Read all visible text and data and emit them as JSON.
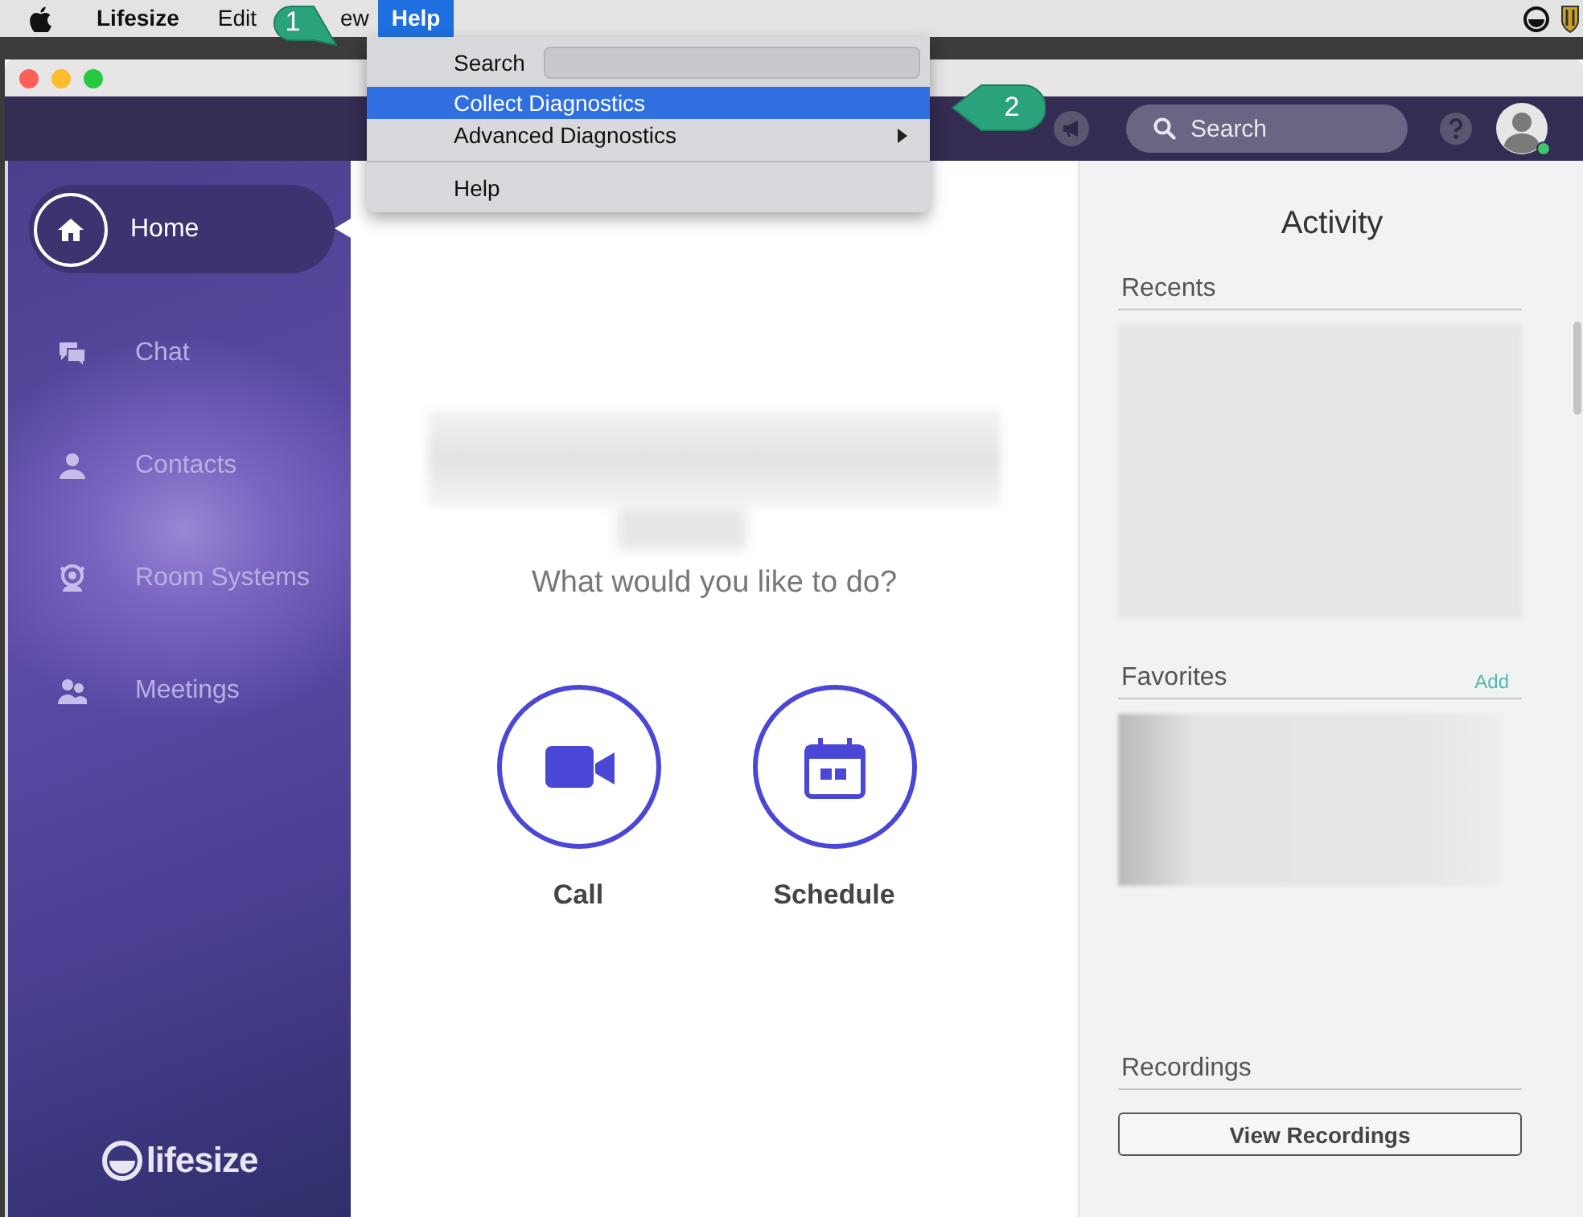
{
  "menu_bar": {
    "items": [
      {
        "label": "Lifesize",
        "kind": "app",
        "selected": false
      },
      {
        "label": "Edit",
        "kind": "menu",
        "selected": false
      },
      {
        "label": "ew",
        "kind": "clipped",
        "selected": false
      },
      {
        "label": "Help",
        "kind": "menu",
        "selected": true
      }
    ]
  },
  "help_menu": {
    "items": [
      {
        "kind": "search",
        "label": "Search"
      },
      {
        "kind": "item",
        "label": "Collect Diagnostics",
        "selected": true,
        "submenu": false
      },
      {
        "kind": "item",
        "label": "Advanced Diagnostics",
        "selected": false,
        "submenu": true
      },
      {
        "kind": "separator"
      },
      {
        "kind": "item",
        "label": "Help",
        "selected": false,
        "submenu": false
      }
    ]
  },
  "callouts": [
    {
      "number": "1"
    },
    {
      "number": "2"
    }
  ],
  "header": {
    "search": {
      "placeholder": "Search"
    },
    "presence_online": true
  },
  "sidebar": {
    "items": [
      {
        "label": "Home",
        "selected": true
      },
      {
        "label": "Chat",
        "selected": false
      },
      {
        "label": "Contacts",
        "selected": false
      },
      {
        "label": "Room Systems",
        "selected": false
      },
      {
        "label": "Meetings",
        "selected": false
      }
    ],
    "logo": "lifesize"
  },
  "main": {
    "prompt": "What would you like to do?",
    "actions": [
      {
        "label": "Call"
      },
      {
        "label": "Schedule"
      }
    ]
  },
  "activity": {
    "title": "Activity",
    "sections": [
      {
        "title": "Recents",
        "kind": "list"
      },
      {
        "title": "Favorites",
        "action": "Add",
        "kind": "list"
      },
      {
        "title": "Recordings",
        "button": "View Recordings",
        "kind": "button"
      }
    ]
  }
}
